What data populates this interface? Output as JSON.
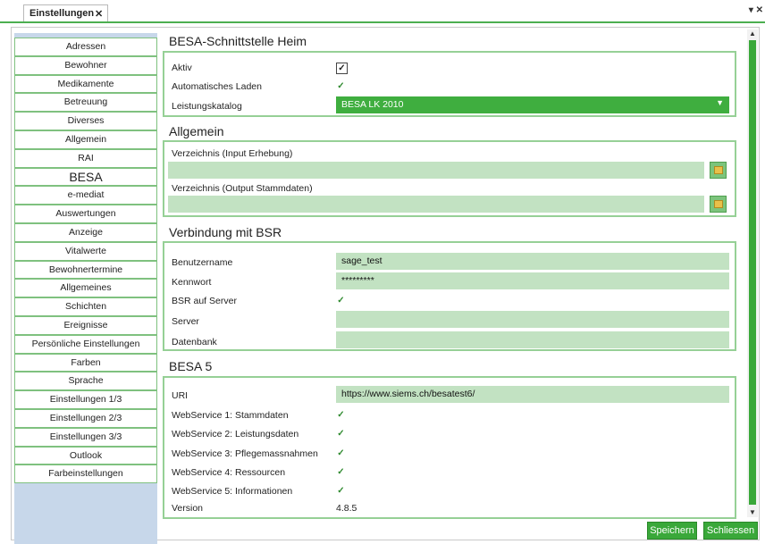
{
  "tab": {
    "label": "Einstellungen",
    "close": "✕"
  },
  "window_controls": "▾ ✕",
  "sidebar": {
    "items": [
      {
        "label": "Adressen"
      },
      {
        "label": "Bewohner"
      },
      {
        "label": "Medikamente"
      },
      {
        "label": "Betreuung"
      },
      {
        "label": "Diverses"
      },
      {
        "label": "Allgemein"
      },
      {
        "label": "RAI"
      },
      {
        "label": "BESA"
      },
      {
        "label": "e-mediat"
      },
      {
        "label": "Auswertungen"
      },
      {
        "label": "Anzeige"
      },
      {
        "label": "Vitalwerte"
      },
      {
        "label": "Bewohnertermine"
      },
      {
        "label": "Allgemeines"
      },
      {
        "label": "Schichten"
      },
      {
        "label": "Ereignisse"
      },
      {
        "label": "Persönliche Einstellungen"
      },
      {
        "label": "Farben"
      },
      {
        "label": "Sprache"
      },
      {
        "label": "Einstellungen 1/3"
      },
      {
        "label": "Einstellungen 2/3"
      },
      {
        "label": "Einstellungen 3/3"
      },
      {
        "label": "Outlook"
      },
      {
        "label": "Farbeinstellungen"
      }
    ],
    "active": "BESA"
  },
  "besa_heim": {
    "title": "BESA-Schnittstelle Heim",
    "aktiv_label": "Aktiv",
    "auto_laden_label": "Automatisches Laden",
    "leistungskatalog_label": "Leistungskatalog",
    "leistungskatalog_value": "BESA LK 2010"
  },
  "allgemein": {
    "title": "Allgemein",
    "input_label": "Verzeichnis (Input Erhebung)",
    "input_value": "",
    "output_label": "Verzeichnis (Output Stammdaten)",
    "output_value": ""
  },
  "bsr": {
    "title": "Verbindung mit BSR",
    "benutzername_label": "Benutzername",
    "benutzername_value": "sage_test",
    "kennwort_label": "Kennwort",
    "kennwort_value": "*********",
    "server_flag_label": "BSR auf Server",
    "server_label": "Server",
    "server_value": "",
    "datenbank_label": "Datenbank",
    "datenbank_value": ""
  },
  "besa5": {
    "title": "BESA 5",
    "uri_label": "URI",
    "uri_value": "https://www.siems.ch/besatest6/",
    "ws1_label": "WebService 1: Stammdaten",
    "ws2_label": "WebService 2: Leistungsdaten",
    "ws3_label": "WebService 3: Pflegemassnahmen",
    "ws4_label": "WebService 4: Ressourcen",
    "ws5_label": "WebService 5: Informationen",
    "version_label": "Version",
    "version_value": "4.8.5"
  },
  "buttons": {
    "save": "Speichern",
    "close": "Schliessen"
  },
  "colors": {
    "accent": "#3aa83a",
    "field_bg": "#c2e2c2",
    "sidebar_bg": "#c7d7ea"
  }
}
